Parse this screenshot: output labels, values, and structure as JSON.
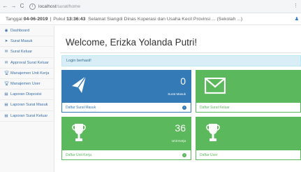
{
  "browser": {
    "back": "←",
    "forward": "→",
    "reload": "C",
    "url_host": "localhost",
    "url_path": "/surat/home",
    "menu": "⋮"
  },
  "datebar": {
    "date_label": "Tanggal",
    "date_value": "04-06-2019",
    "separator": "|",
    "time_label": "Pukul",
    "time_value": "13:36:43",
    "greeting": "Selamat Siang ",
    "description": "di Dinas Koperasi dan Usaha Kecil Provinsi ... (Sekolah ...)"
  },
  "sidebar": {
    "items": [
      {
        "label": "Dashboard"
      },
      {
        "label": "Surat Masuk"
      },
      {
        "label": "Surat Keluar"
      },
      {
        "label": "Approval Surat Keluar"
      },
      {
        "label": "Manajemen Unit Kerja"
      },
      {
        "label": "Manajemen User"
      },
      {
        "label": "Laporan Disposisi"
      },
      {
        "label": "Laporan Surat Masuk"
      },
      {
        "label": "Laporan Surat Keluar"
      }
    ]
  },
  "main": {
    "welcome": "Welcome, Erizka Yolanda Putri!",
    "alert": "Login berhasil!",
    "panels": [
      {
        "count": "0",
        "count_label": "Surat Masuk",
        "footer": "Daftar Surat Masuk"
      },
      {
        "count": "",
        "count_label": "",
        "footer": "Daftar Surat Keluar"
      },
      {
        "count": "36",
        "count_label": "Unit Kerja",
        "footer": "Daftar Unit Kerja"
      },
      {
        "count": "",
        "count_label": "",
        "footer": "Daftar User"
      }
    ]
  },
  "colors": {
    "primary": "#337ab7",
    "success": "#5cb85c",
    "info_bg": "#d9edf7"
  },
  "icons": {
    "panel1": "paper-plane-icon",
    "panel2": "envelope-icon",
    "panel3": "trophy-icon",
    "panel4": "trophy-icon"
  }
}
